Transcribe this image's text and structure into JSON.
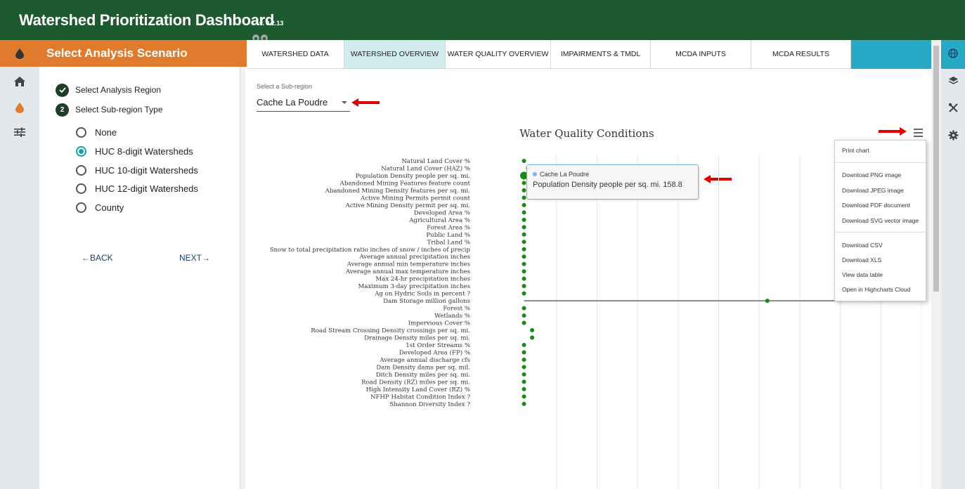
{
  "header": {
    "title": "Watershed Prioritization Dashboard",
    "version": "v. 0.2.13"
  },
  "left_nav": {
    "icons": [
      "water-drop-icon",
      "home-icon",
      "water-drop-icon",
      "sliders-icon"
    ]
  },
  "scenario": {
    "title": "Select Analysis Scenario",
    "steps": [
      {
        "label": "Select Analysis Region",
        "status": "complete"
      },
      {
        "label": "Select Sub-region Type",
        "number": "2"
      }
    ],
    "options": [
      {
        "label": "None",
        "checked": false
      },
      {
        "label": "HUC 8-digit Watersheds",
        "checked": true
      },
      {
        "label": "HUC 10-digit Watersheds",
        "checked": false
      },
      {
        "label": "HUC 12-digit Watersheds",
        "checked": false
      },
      {
        "label": "County",
        "checked": false
      }
    ],
    "back_label": "BACK",
    "next_label": "NEXT"
  },
  "tabs": [
    {
      "label": "WATERSHED DATA",
      "active": false
    },
    {
      "label": "WATERSHED OVERVIEW",
      "active": true
    },
    {
      "label": "WATER QUALITY OVERVIEW",
      "active": false
    },
    {
      "label": "IMPAIRMENTS & TMDL",
      "active": false
    },
    {
      "label": "MCDA INPUTS",
      "active": false
    },
    {
      "label": "MCDA RESULTS",
      "active": false
    }
  ],
  "subregion": {
    "label": "Select a Sub-region",
    "value": "Cache La Poudre"
  },
  "chart_data": {
    "type": "scatter",
    "title": "Water Quality Conditions",
    "categories": [
      "Natural Land Cover %",
      "Natural Land Cover (HAZ) %",
      "Population Density people per sq. mi.",
      "Abandoned Mining Features feature count",
      "Abandoned Mining Density features per sq. mi.",
      "Active Mining Permits permit count",
      "Active Mining Density permit per sq. mi.",
      "Developed Area %",
      "Agricultural Area %",
      "Forest Area %",
      "Public Land %",
      "Tribal Land %",
      "Snow to total precipitation ratio inches of snow / inches of precip",
      "Average annual precipitation inches",
      "Average annual min temperature inches",
      "Average annual max temperature inches",
      "Max 24-hr precipitation inches",
      "Maximum 3-day precipitation inches",
      "Ag on Hydric Soils in percent ?",
      "Dam Storage million gallons",
      "Forest %",
      "Wetlands %",
      "Impervious Cover %",
      "Road Stream Crossing Density crossings per sq. mi.",
      "Drainage Density miles per sq. mi.",
      "1st Order Streams %",
      "Developed Area (FP) %",
      "Average annual discharge cfs",
      "Dam Density dams per sq. mil.",
      "Ditch Density miles per sq. mi.",
      "Road Density (RZ) miles per sq. mi.",
      "High Intensity Land Cover (RZ) %",
      "NFHP Habitat Condition Index ?",
      "Shannon Diversity Index ?"
    ],
    "series": [
      {
        "name": "Cache La Poudre",
        "values": [
          0.2,
          0.3,
          0.2,
          0.2,
          0.2,
          0.2,
          0.2,
          0.2,
          0.2,
          0.2,
          0.2,
          0.2,
          0.2,
          0.2,
          0.2,
          0.2,
          0.2,
          0.2,
          0.2,
          6.2,
          0.2,
          0.2,
          0.2,
          0.4,
          0.4,
          0.2,
          0.2,
          0.2,
          0.2,
          0.2,
          0.2,
          0.2,
          0.2,
          0.2
        ],
        "range": {
          "category": "Dam Storage million gallons",
          "min": 0.2,
          "max": 9.9
        },
        "highlighted": "Population Density people per sq. mi."
      }
    ],
    "xlim": [
      0,
      10
    ],
    "grid": true,
    "color": "#178a17",
    "tooltip": {
      "series": "Cache La Poudre",
      "text": "Population Density people per sq. mi. 158.8"
    }
  },
  "export_menu": [
    "Print chart",
    "Download PNG image",
    "Download JPEG image",
    "Download PDF document",
    "Download SVG vector image",
    "Download CSV",
    "Download XLS",
    "View data table",
    "Open in Highcharts Cloud"
  ],
  "colors": {
    "header_bg": "#1d5a2f",
    "accent_orange": "#e07a2c",
    "tab_strip": "#27a8c4",
    "active_tab": "#d2ebef",
    "radio_checked": "#1aa1a6",
    "annotation_red": "#e00000"
  }
}
